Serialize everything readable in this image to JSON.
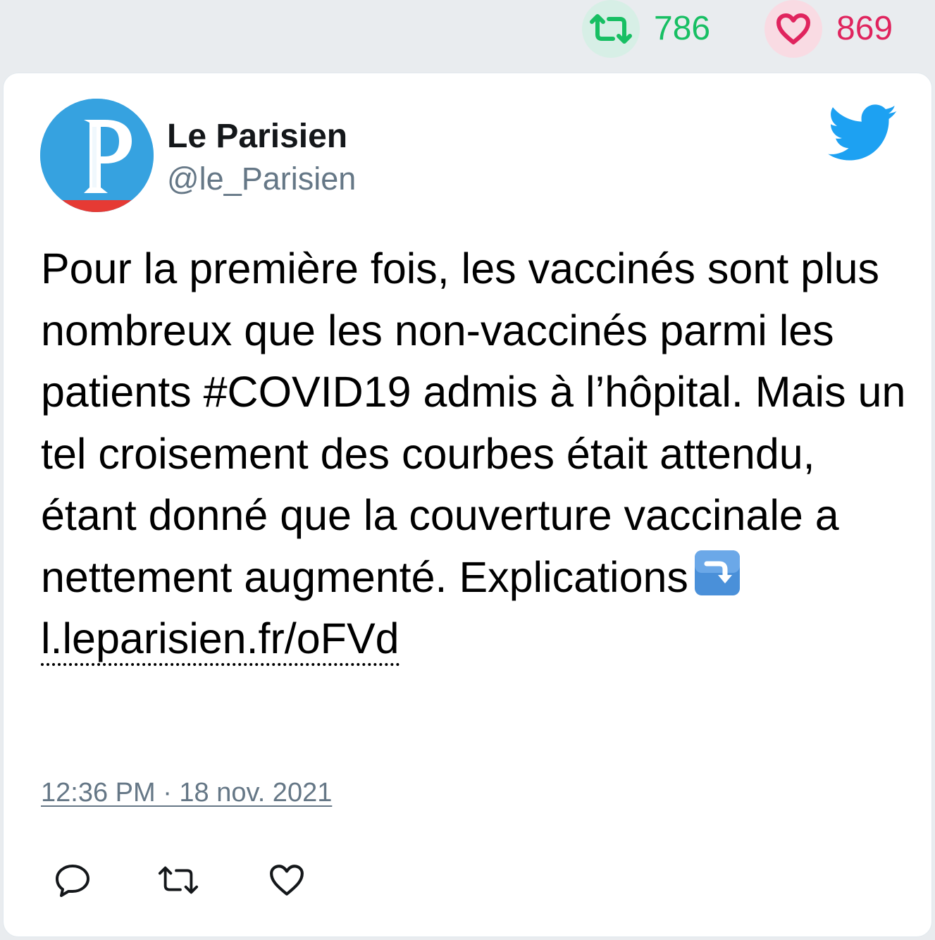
{
  "stats": {
    "retweet_count": "786",
    "like_count": "869",
    "retweet_color": "#17bf63",
    "like_color": "#e0245e"
  },
  "tweet": {
    "author_name": "Le Parisien",
    "author_handle": "@le_Parisien",
    "text": "Pour la première fois, les vaccinés sont plus nombreux que les non-vaccinés parmi les patients #COVID19 admis à l’hôpital. Mais un tel croisement des courbes était attendu, étant donné que la couverture vaccinale a nettement augmenté. Explications",
    "emoji": "arrow-down-right-emoji",
    "link": "l.leparisien.fr/oFVd",
    "timestamp": "12:36 PM · 18 nov. 2021"
  },
  "icons": {
    "retweet": "retweet-icon",
    "like": "heart-icon",
    "reply": "reply-icon",
    "brand": "twitter-bird-icon"
  },
  "brand_color": "#1da1f2"
}
